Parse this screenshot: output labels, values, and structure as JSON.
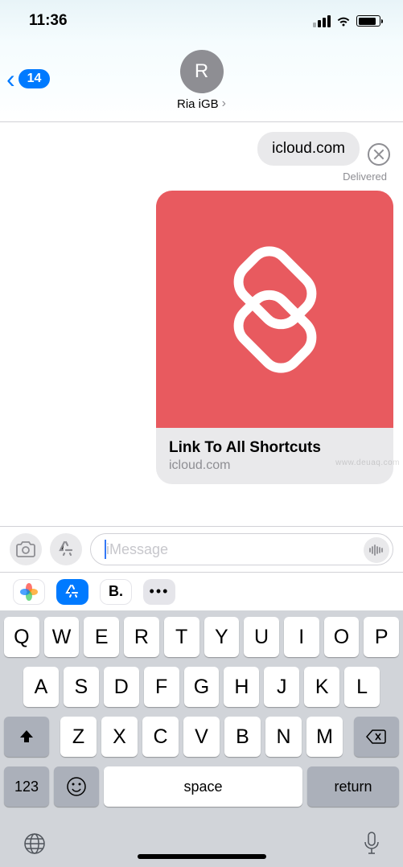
{
  "status": {
    "time": "11:36"
  },
  "header": {
    "back_count": "14",
    "avatar_initial": "R",
    "contact_name": "Ria iGB"
  },
  "messages": {
    "msg1_text": "icloud.com",
    "delivered_label": "Delivered",
    "link_card": {
      "title": "Link To All Shortcuts",
      "domain": "icloud.com"
    }
  },
  "input": {
    "placeholder": "iMessage"
  },
  "app_strip": {
    "bold_label": "B.",
    "more_label": "•••"
  },
  "keyboard": {
    "row1": [
      "Q",
      "W",
      "E",
      "R",
      "T",
      "Y",
      "U",
      "I",
      "O",
      "P"
    ],
    "row2": [
      "A",
      "S",
      "D",
      "F",
      "G",
      "H",
      "J",
      "K",
      "L"
    ],
    "row3": [
      "Z",
      "X",
      "C",
      "V",
      "B",
      "N",
      "M"
    ],
    "num_key": "123",
    "space_label": "space",
    "return_label": "return"
  },
  "watermark": "www.deuaq.com"
}
